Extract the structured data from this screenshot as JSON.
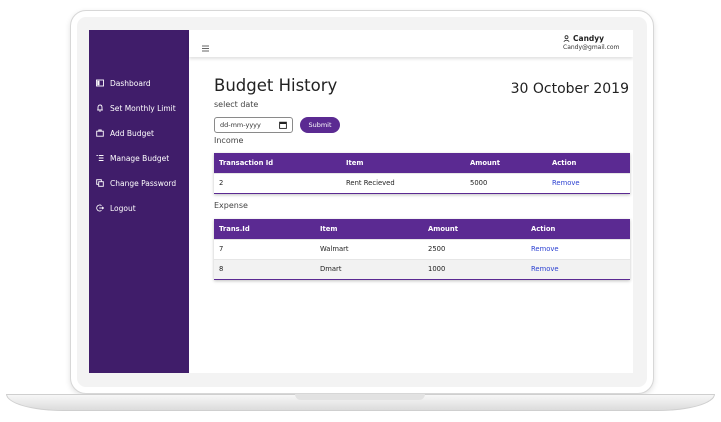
{
  "sidebar": {
    "items": [
      {
        "label": "Dashboard",
        "icon": "dashboard-icon"
      },
      {
        "label": "Set Monthly Limit",
        "icon": "bell-icon"
      },
      {
        "label": "Add Budget",
        "icon": "briefcase-icon"
      },
      {
        "label": "Manage Budget",
        "icon": "list-icon"
      },
      {
        "label": "Change Password",
        "icon": "copy-icon"
      },
      {
        "label": "Logout",
        "icon": "logout-icon"
      }
    ]
  },
  "topbar": {
    "menu_icon": "hamburger-menu-icon",
    "user_name": "Candyy",
    "user_email": "Candy@gmail.com"
  },
  "main": {
    "title": "Budget History",
    "date": "30 October 2019",
    "select_label": "select date",
    "date_placeholder": "dd-mm-yyyy",
    "submit_label": "Submit",
    "income": {
      "title": "Income",
      "columns": [
        "Transaction Id",
        "Item",
        "Amount",
        "Action"
      ],
      "rows": [
        {
          "id": "2",
          "item": "Rent Recieved",
          "amount": "5000",
          "action": "Remove"
        }
      ]
    },
    "expense": {
      "title": "Expense",
      "columns": [
        "Trans.Id",
        "Item",
        "Amount",
        "Action"
      ],
      "rows": [
        {
          "id": "7",
          "item": "Walmart",
          "amount": "2500",
          "action": "Remove"
        },
        {
          "id": "8",
          "item": "Dmart",
          "amount": "1000",
          "action": "Remove"
        }
      ]
    }
  },
  "colors": {
    "sidebar_bg": "#401d6a",
    "accent": "#5b2a92",
    "link": "#2a3fd1"
  }
}
